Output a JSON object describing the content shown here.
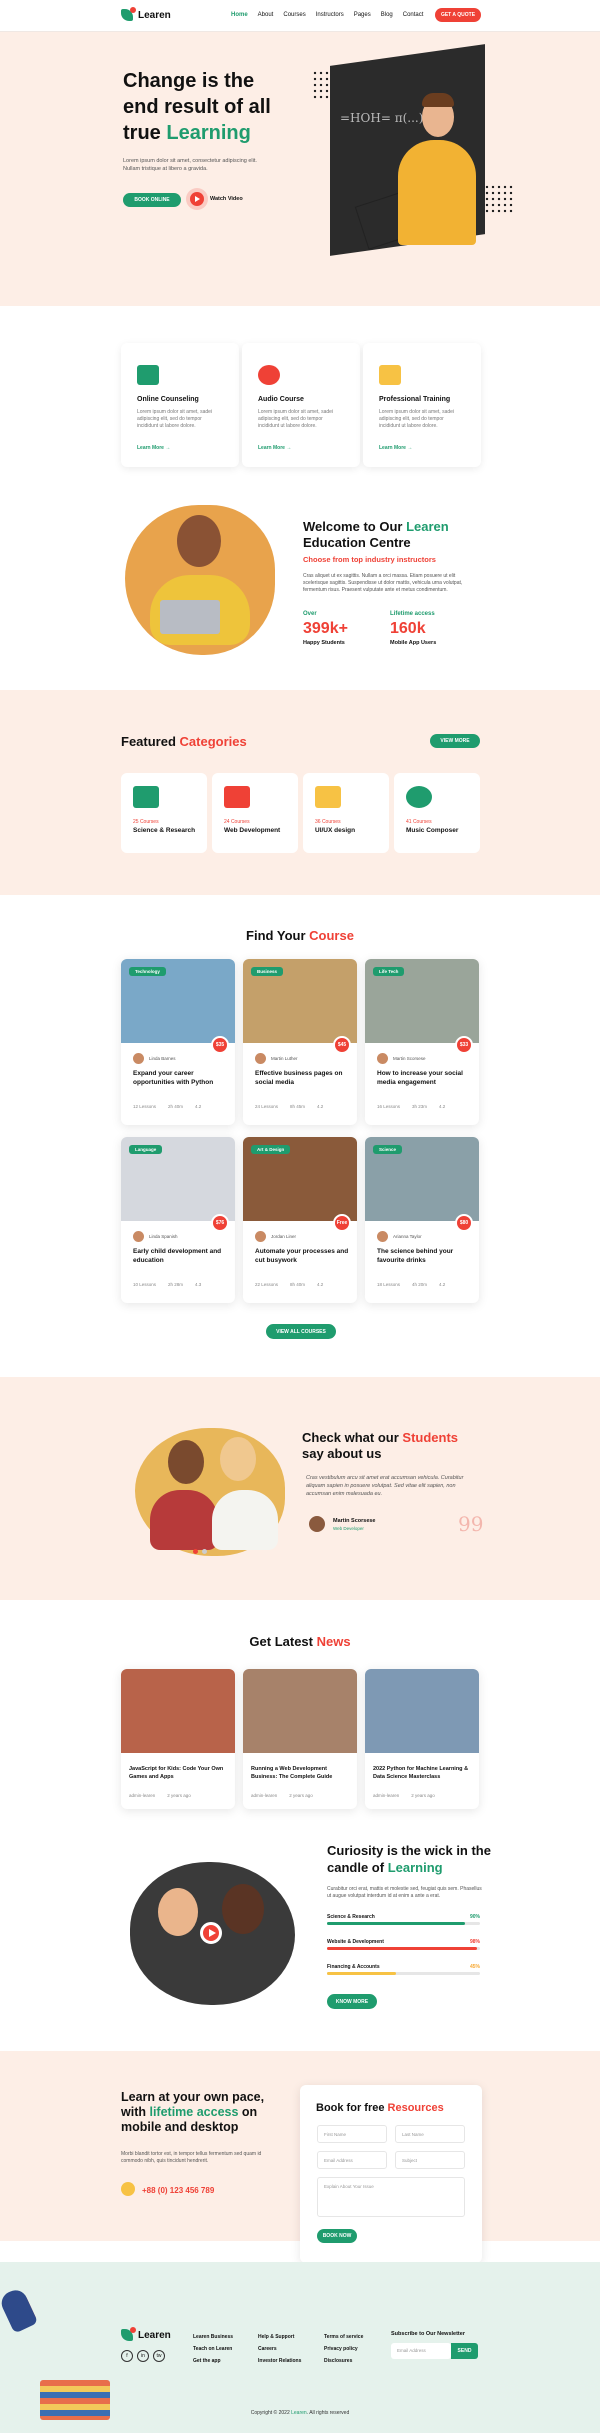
{
  "brand": {
    "name": "Learen",
    "green": "#1f9c6e",
    "red": "#ef4136",
    "peach": "#fdeee6"
  },
  "nav": {
    "items": [
      "Home",
      "About",
      "Courses",
      "Instructors",
      "Pages",
      "Blog",
      "Contact"
    ],
    "cta": "GET A QUOTE"
  },
  "hero": {
    "title_1": "Change is the end result of all true",
    "title_hl": "Learning",
    "desc": "Lorem ipsum dolor sit amet, consectetur adipiscing elit. Nullam tristique at libero a gravida.",
    "btn": "BOOK ONLINE",
    "watch": "Watch Video",
    "board": "=HOH= π(...)"
  },
  "services": [
    {
      "title": "Online Counseling",
      "desc": "Lorem ipsum dolor sit amet, sadei adipiscing elit, sed do tempor incididunt ut labore dolore.",
      "more": "Learn More →",
      "icon": "monitor-icon",
      "color": "#1f9c6e"
    },
    {
      "title": "Audio Course",
      "desc": "Lorem ipsum dolor sit amet, sadei adipiscing elit, sed do tempor incididunt ut labore dolore.",
      "more": "Learn More →",
      "icon": "headphones-icon",
      "color": "#ef4136"
    },
    {
      "title": "Professional Training",
      "desc": "Lorem ipsum dolor sit amet, sadei adipiscing elit, sed do tempor incididunt ut labore dolore.",
      "more": "Learn More →",
      "icon": "presentation-icon",
      "color": "#f7c244"
    }
  ],
  "welcome": {
    "title_1": "Welcome to Our",
    "title_hl": "Learen",
    "title_2": "Education Centre",
    "sub": "Choose from top industry instructors",
    "desc": "Cras aliquet ut ex sagittis. Nullam a orci massa. Etiam posuere ut elit scelerisque sagittis. Suspendisse ut dolor mattis, vehicula urna volutpat, fermentum risus. Praesent vulputate ante et metus condimentum.",
    "stats": [
      {
        "kicker": "Over",
        "value": "399k+",
        "label": "Happy Students"
      },
      {
        "kicker": "Lifetime access",
        "value": "160k",
        "label": "Mobile App Users"
      }
    ]
  },
  "categories": {
    "title_1": "Featured",
    "title_hl": "Categories",
    "view_more": "VIEW MORE",
    "items": [
      {
        "count": "25 Courses",
        "title": "Science & Research",
        "color": "#1f9c6e"
      },
      {
        "count": "24 Courses",
        "title": "Web Development",
        "color": "#ef4136"
      },
      {
        "count": "36 Courses",
        "title": "UI/UX design",
        "color": "#f7c244"
      },
      {
        "count": "41 Courses",
        "title": "Music Composer",
        "color": "#1f9c6e"
      }
    ]
  },
  "courses": {
    "title_1": "Find Your",
    "title_hl": "Course",
    "all": "VIEW ALL COURSES",
    "items": [
      {
        "tag": "Technology",
        "price": "$35",
        "author": "Linda Barnes",
        "title": "Expand your career opportunities with Python",
        "lessons": "12 Lessons",
        "hours": "2h 40m",
        "rating": "4.2",
        "img": "#7aa8c8"
      },
      {
        "tag": "Business",
        "price": "$45",
        "author": "Martin Luther",
        "title": "Effective business pages on social media",
        "lessons": "24 Lessons",
        "hours": "8h 45m",
        "rating": "4.2",
        "img": "#c4a06a"
      },
      {
        "tag": "Life Tech",
        "price": "$33",
        "author": "Martin Scorsese",
        "title": "How to increase your social media engagement",
        "lessons": "16 Lessons",
        "hours": "3h 23m",
        "rating": "4.2",
        "img": "#9aa59a"
      },
      {
        "tag": "Language",
        "price": "$76",
        "author": "Linda Spanish",
        "title": "Early child development and education",
        "lessons": "10 Lessons",
        "hours": "2h 28m",
        "rating": "4.3",
        "img": "#d5d8de"
      },
      {
        "tag": "Art & Design",
        "price": "Free",
        "author": "Jordan Liner",
        "title": "Automate your processes and cut busywork",
        "lessons": "22 Lessons",
        "hours": "8h 40m",
        "rating": "4.2",
        "img": "#8a5a3a"
      },
      {
        "tag": "Science",
        "price": "$80",
        "author": "Arianna Taylor",
        "title": "The science behind your favourite drinks",
        "lessons": "18 Lessons",
        "hours": "4h 20m",
        "rating": "4.2",
        "img": "#8aa0a8"
      }
    ]
  },
  "testimonials": {
    "title_1": "Check what our",
    "title_hl": "Students",
    "title_2": "say about us",
    "quote": "Cras vestibulum arcu sit amet erat accumsan vehicula. Curabitur aliquam sapien in posuere volutpat. Sed vitae elit sapien, non accumsan enim malesuada eu.",
    "name": "Martin Scorsese",
    "role": "Web Developer"
  },
  "news": {
    "title_1": "Get Latest",
    "title_hl": "News",
    "items": [
      {
        "title": "JavaScript for Kids: Code Your Own Games and Apps",
        "author": "admin-learen",
        "date": "2 years ago",
        "img": "#b8634a"
      },
      {
        "title": "Running a Web Development Business: The Complete Guide",
        "author": "admin-learen",
        "date": "2 years ago",
        "img": "#a7826a"
      },
      {
        "title": "2022 Python for Machine Learning & Data Science Masterclass",
        "author": "admin-learen",
        "date": "2 years ago",
        "img": "#7e99b4"
      }
    ]
  },
  "curiosity": {
    "title_1": "Curiosity is the wick in the candle of",
    "title_hl": "Learning",
    "desc": "Curabitur orci erat, mattis et molestie sed, feugiat quis sem. Phasellus ut augue volutpat interdum id at enim a ante a erat.",
    "bars": [
      {
        "label": "Science & Research",
        "value": "90%",
        "frac": 0.9,
        "color": "#1f9c6e"
      },
      {
        "label": "Website & Development",
        "value": "98%",
        "frac": 0.98,
        "color": "#ef4136"
      },
      {
        "label": "Financing & Accounts",
        "value": "45%",
        "frac": 0.45,
        "color": "#f7c244"
      }
    ],
    "btn": "KNOW MORE"
  },
  "learn": {
    "title_1": "Learn at your own pace, with",
    "title_hl": "lifetime access",
    "title_2": "on mobile and desktop",
    "desc": "Morbi blandit tortor est, in tempor tellus fermentum sed quam id commodo nibh, quis tincidunt hendrerit.",
    "phone": "+88 (0) 123 456 789"
  },
  "form": {
    "title_1": "Book for free",
    "title_hl": "Resources",
    "first": "First Name",
    "last": "Last Name",
    "email": "Email Address",
    "subject": "Subject",
    "message": "Explain About Your Issue",
    "btn": "BOOK NOW"
  },
  "footer": {
    "cols": [
      [
        "Learen Business",
        "Teach on Learen",
        "Get the app"
      ],
      [
        "Help & Support",
        "Careers",
        "Investor Relations"
      ],
      [
        "Terms of service",
        "Privacy policy",
        "Disclosures"
      ]
    ],
    "newsletter": "Subscribe to Our Newsletter",
    "email_ph": "Email Address",
    "send": "SEND",
    "social": [
      "f",
      "in",
      "tw"
    ],
    "copy_1": "Copyright © 2022",
    "copy_brand": "Learen",
    "copy_2": ". All rights reserved"
  }
}
